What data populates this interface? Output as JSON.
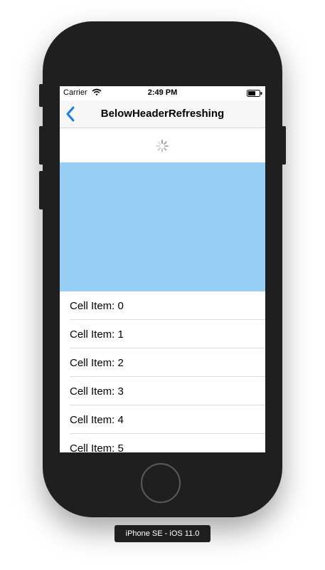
{
  "status_bar": {
    "carrier": "Carrier",
    "time": "2:49 PM",
    "wifi_icon": "wifi-icon",
    "battery_icon": "battery-icon"
  },
  "nav_bar": {
    "title": "BelowHeaderRefreshing",
    "back_icon": "chevron-left-icon",
    "accent_color": "#1a7cf6"
  },
  "refresh": {
    "indicator_icon": "activity-spinner-icon"
  },
  "header_banner": {
    "color": "#96cef5"
  },
  "cells": [
    {
      "label": "Cell Item: 0"
    },
    {
      "label": "Cell Item: 1"
    },
    {
      "label": "Cell Item: 2"
    },
    {
      "label": "Cell Item: 3"
    },
    {
      "label": "Cell Item: 4"
    },
    {
      "label": "Cell Item: 5"
    }
  ],
  "simulator": {
    "device_label": "iPhone SE - iOS 11.0"
  }
}
